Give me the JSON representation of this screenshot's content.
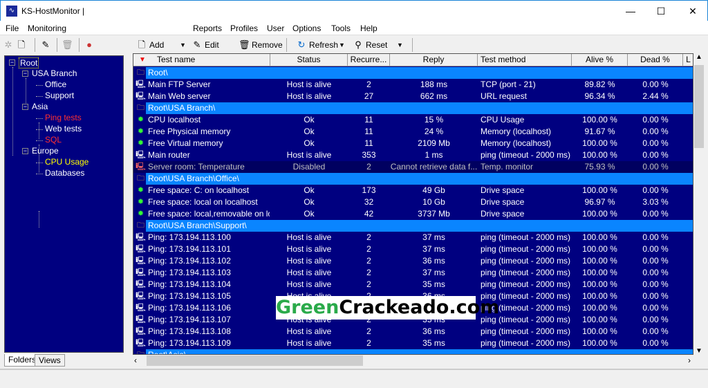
{
  "title": "KS-HostMonitor  |",
  "menu": [
    "File",
    "Monitoring",
    "Reports",
    "Profiles",
    "User",
    "Options",
    "Tools",
    "Help"
  ],
  "toolbar": {
    "add": "Add",
    "edit": "Edit",
    "remove": "Remove",
    "refresh": "Refresh",
    "reset": "Reset"
  },
  "tree": [
    {
      "label": "Root",
      "level": 0,
      "color": "#ffffff"
    },
    {
      "label": "USA Branch",
      "level": 1,
      "color": "#ffffff"
    },
    {
      "label": "Office",
      "level": 2,
      "color": "#ffffff"
    },
    {
      "label": "Support",
      "level": 2,
      "color": "#ffffff"
    },
    {
      "label": "Asia",
      "level": 1,
      "color": "#ffffff"
    },
    {
      "label": "Ping tests",
      "level": 2,
      "color": "#ff3030"
    },
    {
      "label": "Web tests",
      "level": 2,
      "color": "#ffffff"
    },
    {
      "label": "SQL",
      "level": 2,
      "color": "#ff3030"
    },
    {
      "label": "Europe",
      "level": 1,
      "color": "#ffffff"
    },
    {
      "label": "CPU Usage",
      "level": 2,
      "color": "#ffff00"
    },
    {
      "label": "Databases",
      "level": 2,
      "color": "#ffffff"
    }
  ],
  "tabs": [
    "Folders",
    "Views"
  ],
  "columns": [
    "Test name",
    "Status",
    "Recurre...",
    "Reply",
    "Test method",
    "Alive %",
    "Dead %",
    "L"
  ],
  "rows": [
    {
      "group": "Root\\"
    },
    {
      "icon": "pc",
      "cells": [
        "Main FTP Server",
        "Host is alive",
        "2",
        "188 ms",
        "TCP (port - 21)",
        "89.82 %",
        "0.00 %"
      ]
    },
    {
      "icon": "pc",
      "cells": [
        "Main Web server",
        "Host is alive",
        "27",
        "662 ms",
        "URL request",
        "96.34 %",
        "2.44 %"
      ]
    },
    {
      "group": "Root\\USA Branch\\"
    },
    {
      "icon": "gear",
      "cells": [
        "CPU localhost",
        "Ok",
        "11",
        "15 %",
        "CPU Usage",
        "100.00 %",
        "0.00 %"
      ]
    },
    {
      "icon": "gear",
      "cells": [
        "Free Physical memory",
        "Ok",
        "11",
        "24 %",
        "Memory (localhost)",
        "91.67 %",
        "0.00 %"
      ]
    },
    {
      "icon": "gear",
      "cells": [
        "Free Virtual memory",
        "Ok",
        "11",
        "2109 Mb",
        "Memory (localhost)",
        "100.00 %",
        "0.00 %"
      ]
    },
    {
      "icon": "pc",
      "cells": [
        "Main router",
        "Host is alive",
        "353",
        "1 ms",
        "ping (timeout - 2000 ms)",
        "100.00 %",
        "0.00 %"
      ]
    },
    {
      "icon": "pc-red",
      "disabled": true,
      "cells": [
        "Server room: Temperature",
        "Disabled",
        "2",
        "Cannot retrieve data f...",
        "Temp. monitor",
        "75.93 %",
        "0.00 %"
      ]
    },
    {
      "group": "Root\\USA Branch\\Office\\"
    },
    {
      "icon": "gear",
      "cells": [
        "Free space: C: on localhost",
        "Ok",
        "173",
        "49 Gb",
        "Drive space",
        "100.00 %",
        "0.00 %"
      ]
    },
    {
      "icon": "gear",
      "cells": [
        "Free space: local on localhost",
        "Ok",
        "32",
        "10 Gb",
        "Drive space",
        "96.97 %",
        "3.03 %"
      ]
    },
    {
      "icon": "gear",
      "cells": [
        "Free space: local,removable on loc...",
        "Ok",
        "42",
        "3737 Mb",
        "Drive space",
        "100.00 %",
        "0.00 %"
      ]
    },
    {
      "group": "Root\\USA Branch\\Support\\"
    },
    {
      "icon": "pc",
      "cells": [
        "Ping: 173.194.113.100",
        "Host is alive",
        "2",
        "37 ms",
        "ping (timeout - 2000 ms)",
        "100.00 %",
        "0.00 %"
      ]
    },
    {
      "icon": "pc",
      "cells": [
        "Ping: 173.194.113.101",
        "Host is alive",
        "2",
        "37 ms",
        "ping (timeout - 2000 ms)",
        "100.00 %",
        "0.00 %"
      ]
    },
    {
      "icon": "pc",
      "cells": [
        "Ping: 173.194.113.102",
        "Host is alive",
        "2",
        "36 ms",
        "ping (timeout - 2000 ms)",
        "100.00 %",
        "0.00 %"
      ]
    },
    {
      "icon": "pc",
      "cells": [
        "Ping: 173.194.113.103",
        "Host is alive",
        "2",
        "37 ms",
        "ping (timeout - 2000 ms)",
        "100.00 %",
        "0.00 %"
      ]
    },
    {
      "icon": "pc",
      "cells": [
        "Ping: 173.194.113.104",
        "Host is alive",
        "2",
        "35 ms",
        "ping (timeout - 2000 ms)",
        "100.00 %",
        "0.00 %"
      ]
    },
    {
      "icon": "pc",
      "cells": [
        "Ping: 173.194.113.105",
        "Host is alive",
        "2",
        "36 ms",
        "ping (timeout - 2000 ms)",
        "100.00 %",
        "0.00 %"
      ]
    },
    {
      "icon": "pc",
      "cells": [
        "Ping: 173.194.113.106",
        "",
        "",
        "",
        "ping (timeout - 2000 ms)",
        "100.00 %",
        "0.00 %"
      ]
    },
    {
      "icon": "pc",
      "cells": [
        "Ping: 173.194.113.107",
        "Host is alive",
        "2",
        "35 ms",
        "ping (timeout - 2000 ms)",
        "100.00 %",
        "0.00 %"
      ]
    },
    {
      "icon": "pc",
      "cells": [
        "Ping: 173.194.113.108",
        "Host is alive",
        "2",
        "36 ms",
        "ping (timeout - 2000 ms)",
        "100.00 %",
        "0.00 %"
      ]
    },
    {
      "icon": "pc",
      "cells": [
        "Ping: 173.194.113.109",
        "Host is alive",
        "2",
        "35 ms",
        "ping (timeout - 2000 ms)",
        "100.00 %",
        "0.00 %"
      ]
    },
    {
      "group": "Root\\Asia\\"
    }
  ],
  "watermark": {
    "green": "Green",
    "black": "Crackeado.com"
  }
}
